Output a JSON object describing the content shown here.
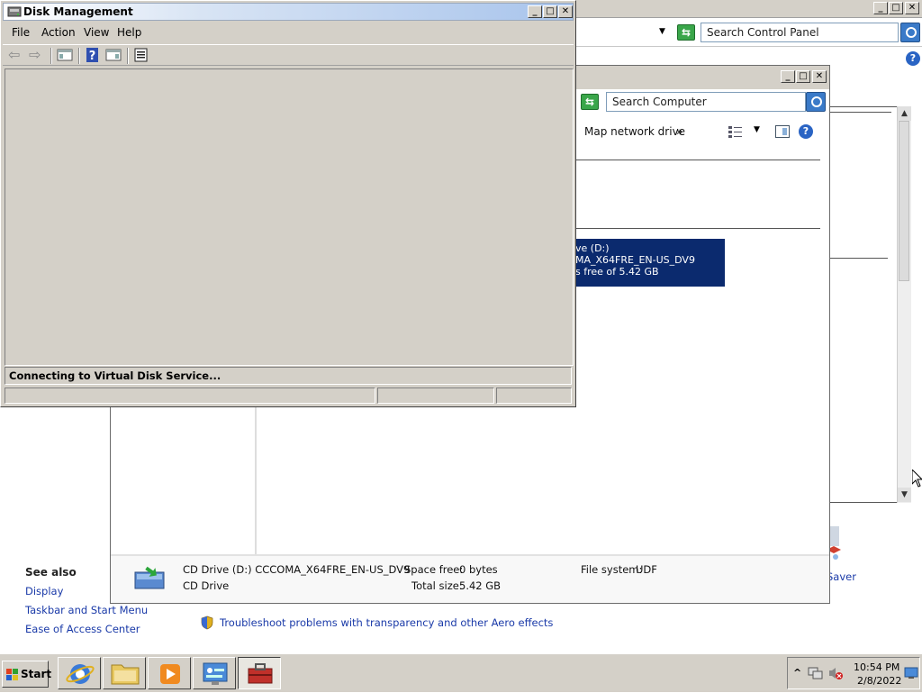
{
  "control_panel": {
    "search_placeholder": "Search Control Panel",
    "see_also": {
      "title": "See also",
      "links": [
        "Display",
        "Taskbar and Start Menu",
        "Ease of Access Center"
      ]
    },
    "troubleshoot_link": "Troubleshoot problems with transparency and other Aero effects",
    "partial_item_label": "Saver"
  },
  "computer_window": {
    "search_placeholder": "Search Computer",
    "toolbar": {
      "map_network_drive": "Map network drive",
      "more": "»"
    },
    "drive_tile": {
      "line1": "ve (D:)",
      "line2": "MA_X64FRE_EN-US_DV9",
      "line3": "s free of 5.42 GB"
    },
    "details": {
      "name": "CD Drive (D:) CCCOMA_X64FRE_EN-US_DV9",
      "type": "CD Drive",
      "space_free_label": "Space free:",
      "space_free_value": "0 bytes",
      "total_size_label": "Total size:",
      "total_size_value": "5.42 GB",
      "file_system_label": "File system:",
      "file_system_value": "UDF"
    }
  },
  "disk_management": {
    "title": "Disk Management",
    "menu": [
      "File",
      "Action",
      "View",
      "Help"
    ],
    "status": "Connecting to Virtual Disk Service..."
  },
  "window_buttons": {
    "minimize": "_",
    "maximize": "□",
    "close": "✕"
  },
  "taskbar": {
    "start_label": "Start",
    "clock_time": "10:54 PM",
    "clock_date": "2/8/2022",
    "tray_expand": "^"
  },
  "colors": {
    "accent_blue": "#0b2a6e",
    "link_blue": "#1a3aa8",
    "chrome_gray": "#d4d0c8"
  }
}
